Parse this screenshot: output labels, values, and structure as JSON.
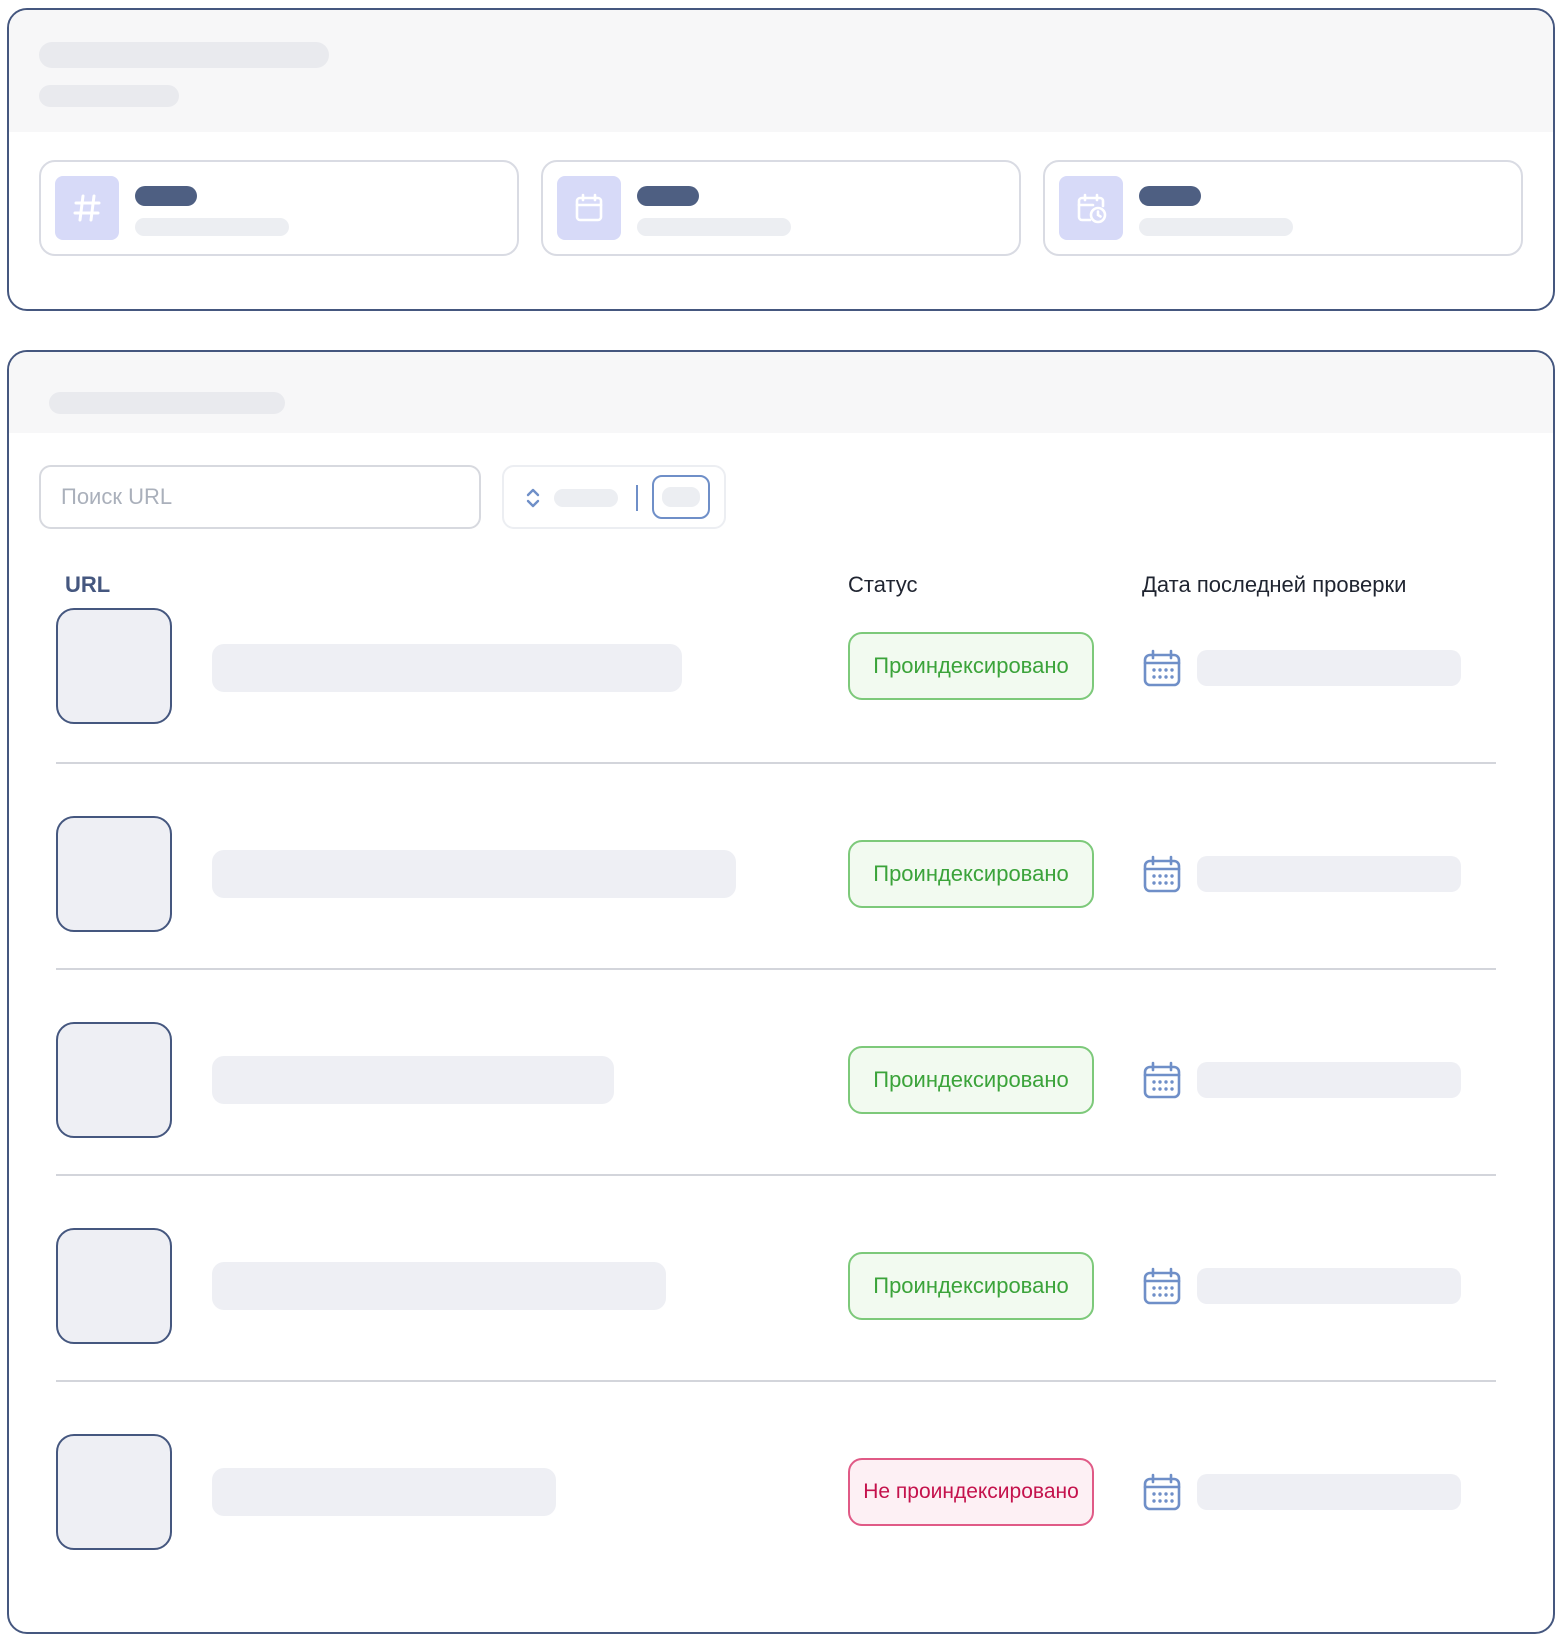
{
  "search": {
    "placeholder": "Поиск URL"
  },
  "table": {
    "headers": {
      "url": "URL",
      "status": "Статус",
      "last_check": "Дата последней проверки"
    },
    "rows": [
      {
        "status": "Проиндексировано",
        "state": "indexed"
      },
      {
        "status": "Проиндексировано",
        "state": "indexed"
      },
      {
        "status": "Проиндексировано",
        "state": "indexed"
      },
      {
        "status": "Проиндексировано",
        "state": "indexed"
      },
      {
        "status": "Не проиндексировано",
        "state": "not-indexed"
      }
    ]
  },
  "stats": [
    {
      "icon": "hash-icon"
    },
    {
      "icon": "calendar-icon"
    },
    {
      "icon": "calendar-clock-icon"
    }
  ],
  "colors": {
    "border": "#45577f",
    "accent": "#6f8fc8",
    "ok_text": "#3ba33a",
    "ok_border": "#7dc97a",
    "bad_text": "#c4124c",
    "bad_border": "#e05a86"
  }
}
